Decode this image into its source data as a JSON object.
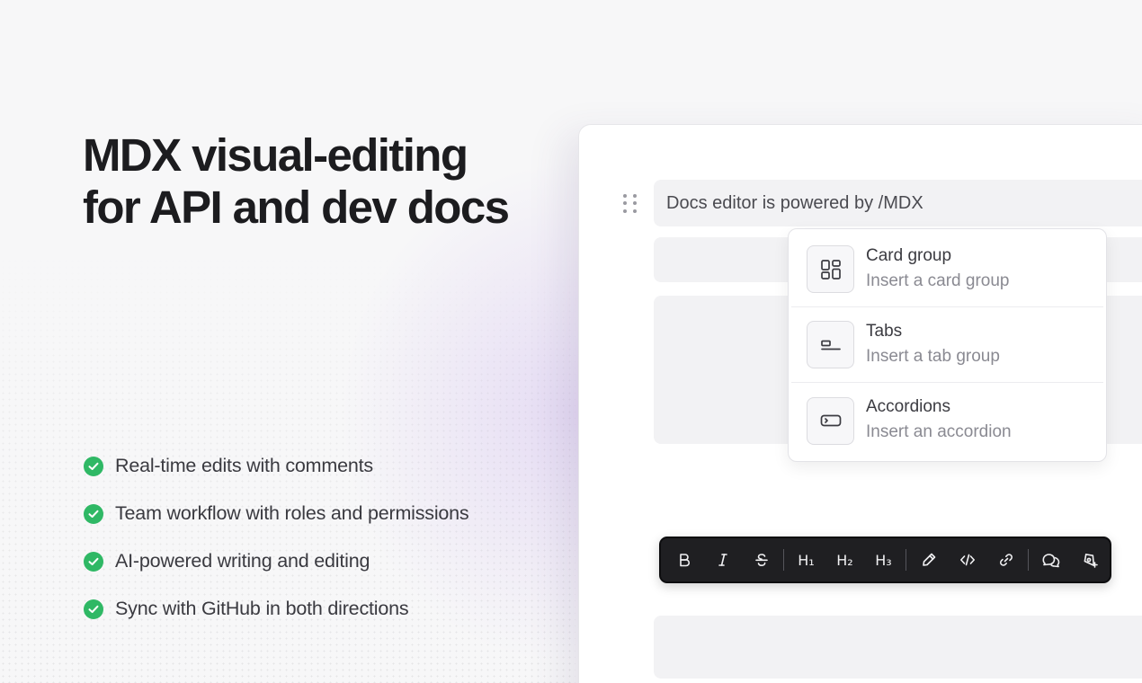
{
  "headline": {
    "line1": "MDX visual-editing",
    "line2": "for API and dev docs"
  },
  "features": [
    {
      "text": "Real-time edits with comments",
      "icon": "check-circle-icon"
    },
    {
      "text": "Team workflow with roles and permissions",
      "icon": "check-circle-icon"
    },
    {
      "text": "AI-powered writing and editing",
      "icon": "check-circle-icon"
    },
    {
      "text": "Sync with GitHub in both directions",
      "icon": "check-circle-icon"
    }
  ],
  "editor": {
    "line_text": "Docs editor is powered by /MDX"
  },
  "slash_menu": {
    "items": [
      {
        "title": "Card group",
        "description": "Insert a card group",
        "icon": "card-group-icon"
      },
      {
        "title": "Tabs",
        "description": "Insert a tab group",
        "icon": "tabs-icon"
      },
      {
        "title": "Accordions",
        "description": "Insert an accordion",
        "icon": "accordion-icon"
      }
    ]
  },
  "toolbar": {
    "h1_label": "H₁",
    "h2_label": "H₂",
    "h3_label": "H₃",
    "buttons": [
      "bold-icon",
      "italic-icon",
      "strikethrough-icon",
      "heading-1",
      "heading-2",
      "heading-3",
      "highlight-pen-icon",
      "code-icon",
      "link-icon",
      "comment-icon",
      "ai-assist-icon"
    ]
  },
  "colors": {
    "accent_green": "#2fb865",
    "toolbar_bg": "#1f1f22",
    "glow": "#d6c4f0"
  }
}
